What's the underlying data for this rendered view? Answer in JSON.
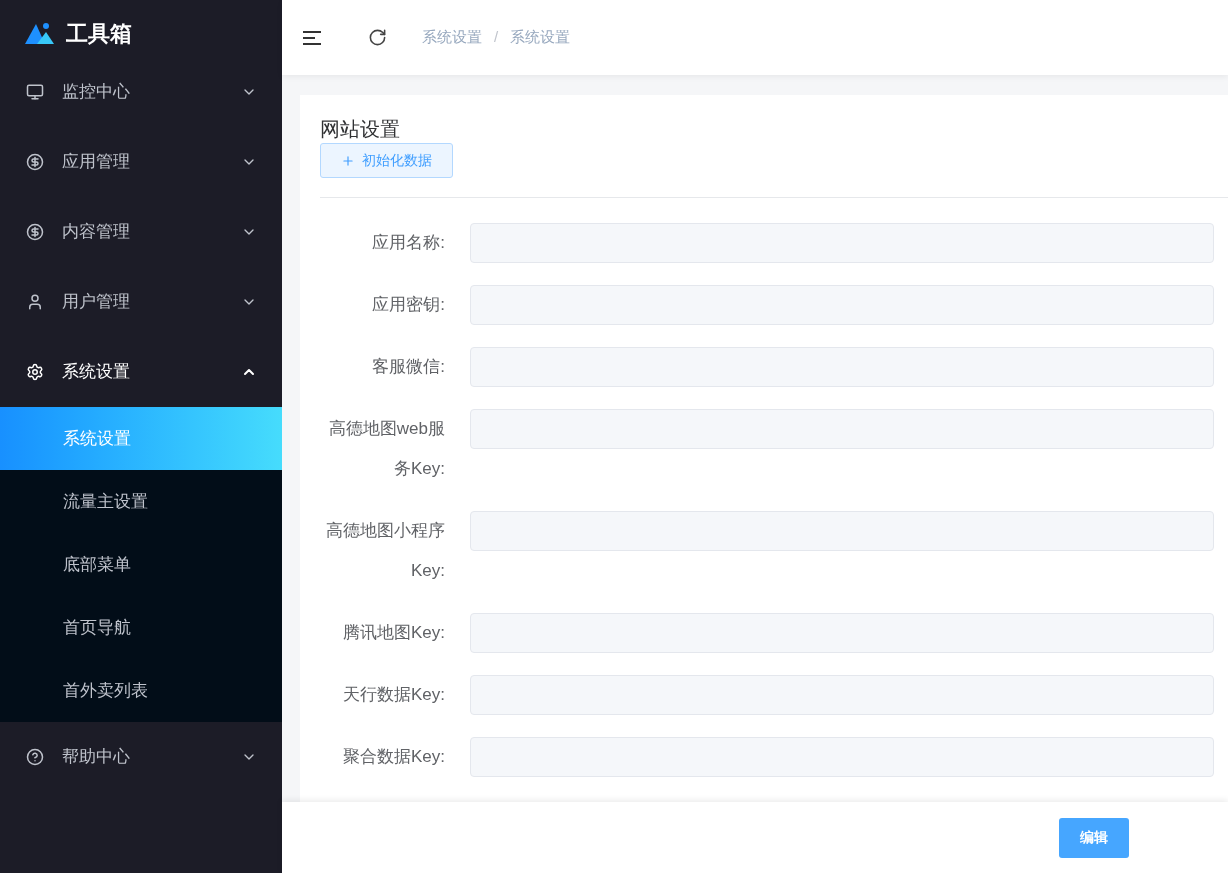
{
  "sidebar": {
    "logo": "工具箱",
    "menu": [
      {
        "label": "监控中心",
        "expanded": false
      },
      {
        "label": "应用管理",
        "expanded": false
      },
      {
        "label": "内容管理",
        "expanded": false
      },
      {
        "label": "用户管理",
        "expanded": false
      },
      {
        "label": "系统设置",
        "expanded": true,
        "children": [
          {
            "label": "系统设置",
            "selected": true
          },
          {
            "label": "流量主设置",
            "selected": false
          },
          {
            "label": "底部菜单",
            "selected": false
          },
          {
            "label": "首页导航",
            "selected": false
          },
          {
            "label": "首外卖列表",
            "selected": false
          }
        ]
      },
      {
        "label": "帮助中心",
        "expanded": false
      }
    ]
  },
  "header": {
    "breadcrumb": [
      "系统设置",
      "系统设置"
    ],
    "separator": "/"
  },
  "card": {
    "title": "网站设置",
    "init_button": "初始化数据",
    "fields": [
      {
        "label": "应用名称:"
      },
      {
        "label": "应用密钥:"
      },
      {
        "label": "客服微信:"
      },
      {
        "label": "高德地图web服务Key:"
      },
      {
        "label": "高德地图小程序Key:"
      },
      {
        "label": "腾讯地图Key:"
      },
      {
        "label": "天行数据Key:"
      },
      {
        "label": "聚合数据Key:"
      }
    ]
  },
  "footer": {
    "edit_button": "编辑"
  }
}
